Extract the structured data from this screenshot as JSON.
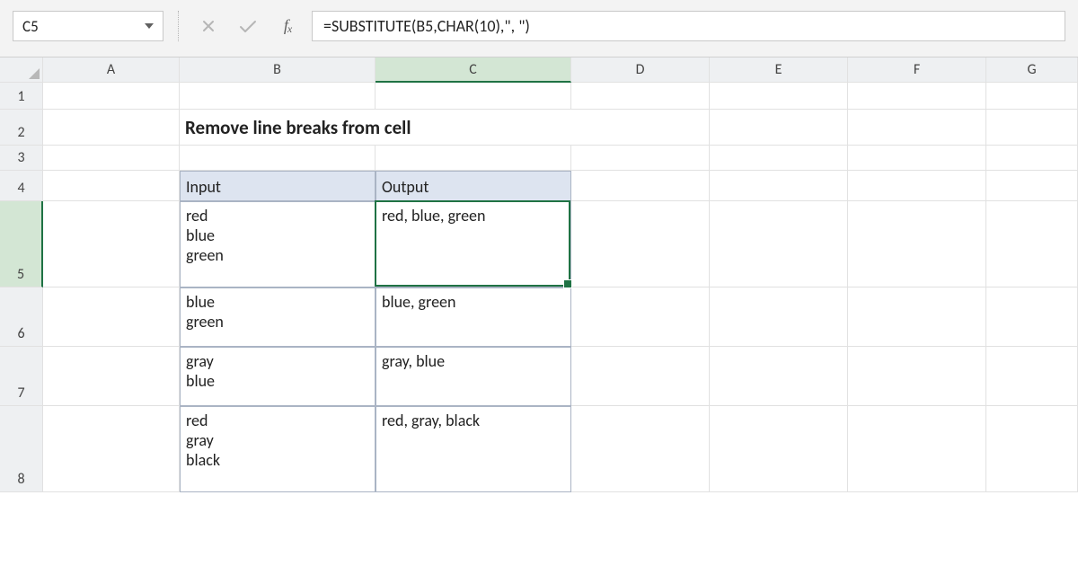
{
  "name_box": "C5",
  "formula": "=SUBSTITUTE(B5,CHAR(10),\", \")",
  "title": "Remove line breaks from cell",
  "columns": [
    "A",
    "B",
    "C",
    "D",
    "E",
    "F",
    "G"
  ],
  "rows": [
    "1",
    "2",
    "3",
    "4",
    "5",
    "6",
    "7",
    "8"
  ],
  "table": {
    "headers": {
      "input": "Input",
      "output": "Output"
    },
    "rows": [
      {
        "input": "red\nblue\ngreen",
        "output": "red, blue, green"
      },
      {
        "input": "blue\ngreen",
        "output": "blue, green"
      },
      {
        "input": "gray\nblue",
        "output": "gray, blue"
      },
      {
        "input": "red\ngray\nblack",
        "output": "red, gray, black"
      }
    ]
  },
  "selected_cell": "C5",
  "chart_data": {
    "type": "table",
    "title": "Remove line breaks from cell",
    "columns": [
      "Input",
      "Output"
    ],
    "rows": [
      [
        "red\\nblue\\ngreen",
        "red, blue, green"
      ],
      [
        "blue\\ngreen",
        "blue, green"
      ],
      [
        "gray\\nblue",
        "gray, blue"
      ],
      [
        "red\\ngray\\nblack",
        "red, gray, black"
      ]
    ],
    "formula": "=SUBSTITUTE(B5,CHAR(10),\", \")"
  }
}
